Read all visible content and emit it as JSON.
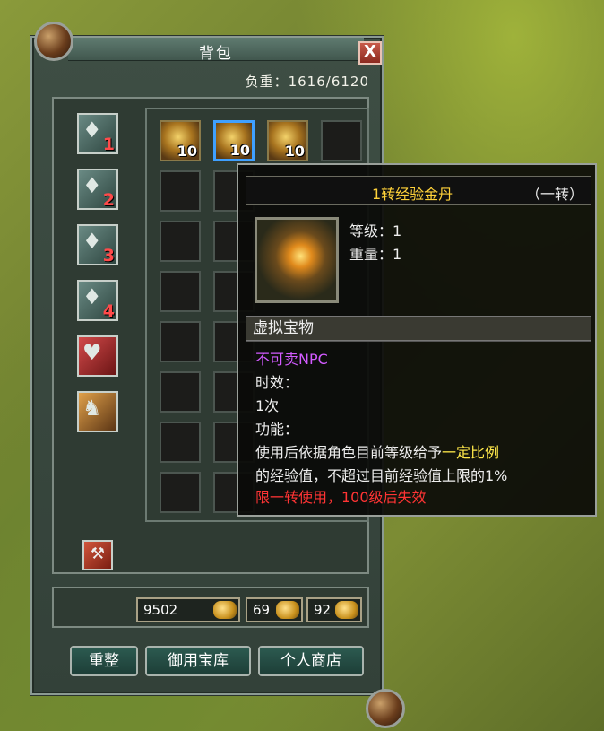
{
  "window": {
    "title": "背包",
    "close_label": "X",
    "weight_label": "负重：1616/6120"
  },
  "bag_tabs": [
    {
      "icon": "bag-icon",
      "number": "1"
    },
    {
      "icon": "bag-icon",
      "number": "2"
    },
    {
      "icon": "bag-icon",
      "number": "3"
    },
    {
      "icon": "bag-icon",
      "number": "4"
    },
    {
      "icon": "armor-icon",
      "number": ""
    },
    {
      "icon": "mount-icon",
      "number": ""
    }
  ],
  "slots": [
    {
      "qty": "10"
    },
    {
      "qty": "10"
    },
    {
      "qty": "10"
    },
    {
      "qty": ""
    }
  ],
  "currency": {
    "gold": "9502",
    "coupon": "69",
    "points": "92"
  },
  "buttons": {
    "sort": "重整",
    "vault": "御用宝库",
    "shop": "个人商店"
  },
  "tooltip": {
    "name": "1转经验金丹",
    "rank": "（一转）",
    "level": "等级：1",
    "weight": "重量：1",
    "type": "虚拟宝物",
    "unsellable": "不可卖NPC",
    "duration_label": "时效：",
    "duration_value": "1次",
    "function_label": "功能：",
    "desc_part1": "使用后依据角色目前等级给予",
    "desc_highlight": "一定比例",
    "desc_line2": "的经验值，不超过目前经验值上限的1%",
    "restriction": "限一转使用，100级后失效"
  }
}
